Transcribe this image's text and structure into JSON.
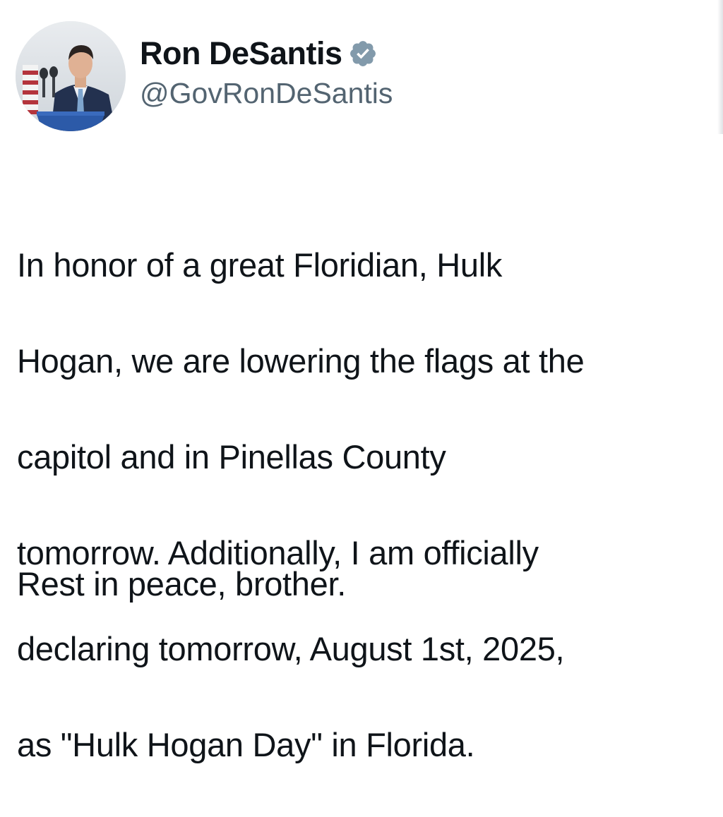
{
  "author": {
    "display_name": "Ron DeSantis",
    "handle": "@GovRonDeSantis",
    "verified": true,
    "verified_icon": "verified-badge-icon",
    "badge_color": "#829aab"
  },
  "tweet": {
    "body_lines": [
      "In honor of a great Floridian, Hulk",
      "Hogan, we are lowering the flags at the",
      "capitol and in Pinellas County",
      "tomorrow. Additionally, I am officially",
      "declaring tomorrow, August 1st, 2025,",
      "as \"Hulk Hogan Day\" in Florida."
    ],
    "closing": "Rest in peace, brother."
  },
  "colors": {
    "text_primary": "#0f1419",
    "text_secondary": "#536471",
    "background": "#ffffff"
  }
}
